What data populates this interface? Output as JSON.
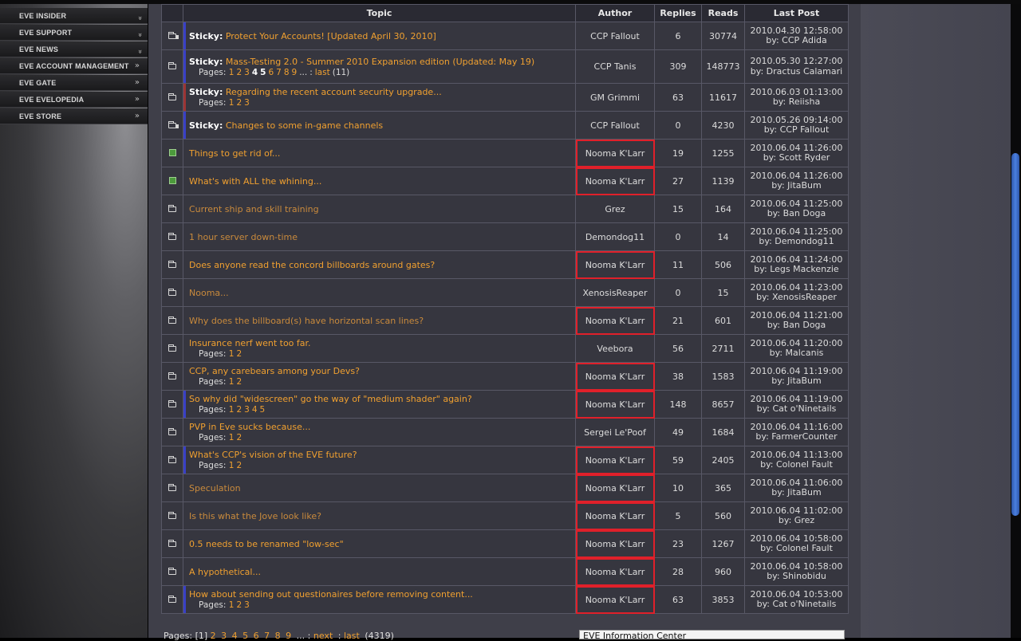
{
  "sidebar": {
    "items": [
      {
        "label": "EVE INSIDER",
        "chevron": "double-down"
      },
      {
        "label": "EVE SUPPORT",
        "chevron": "double-down"
      },
      {
        "label": "EVE NEWS",
        "chevron": "double-down"
      },
      {
        "label": "EVE ACCOUNT MANAGEMENT",
        "chevron": "double-right"
      },
      {
        "label": "EVE GATE",
        "chevron": "double-right"
      },
      {
        "label": "EVE EVELOPEDIA",
        "chevron": "double-right"
      },
      {
        "label": "EVE STORE",
        "chevron": "double-right"
      }
    ]
  },
  "table": {
    "headers": {
      "topic": "Topic",
      "author": "Author",
      "replies": "Replies",
      "reads": "Reads",
      "last_post": "Last Post"
    },
    "rows": [
      {
        "icon": "sticky-folder",
        "bar": "blue",
        "sticky": "Sticky:",
        "title": "Protect Your Accounts! [Updated April 30, 2010]",
        "pages": [],
        "author": "CCP Fallout",
        "marked": false,
        "replies": "6",
        "reads": "30774",
        "date": "2010.04.30 12:58:00",
        "by": "by: CCP Adida"
      },
      {
        "icon": "folder",
        "bar": "blue",
        "sticky": "Sticky:",
        "title": "Mass-Testing 2.0 - Summer 2010 Expansion edition (Updated: May 19)",
        "pages": [
          "1",
          "2",
          "3",
          "4",
          "5",
          "6",
          "7",
          "8",
          "9",
          "...",
          ":",
          "last",
          "(11)"
        ],
        "author": "CCP Tanis",
        "marked": false,
        "replies": "309",
        "reads": "148773",
        "date": "2010.05.30 12:27:00",
        "by": "by: Dractus Calamari",
        "tall": true
      },
      {
        "icon": "folder",
        "bar": "red",
        "sticky": "Sticky:",
        "title": "Regarding the recent account security upgrade...",
        "pages": [
          "1",
          "2",
          "3"
        ],
        "author": "GM Grimmi",
        "marked": false,
        "replies": "63",
        "reads": "11617",
        "date": "2010.06.03 01:13:00",
        "by": "by: Reiisha"
      },
      {
        "icon": "sticky-folder",
        "bar": "blue",
        "sticky": "Sticky:",
        "title": "Changes to some in-game channels",
        "pages": [],
        "author": "CCP Fallout",
        "marked": false,
        "replies": "0",
        "reads": "4230",
        "date": "2010.05.26 09:14:00",
        "by": "by: CCP Fallout"
      },
      {
        "icon": "hot",
        "bar": "",
        "sticky": "",
        "title": "Things to get rid of...",
        "pages": [],
        "author": "Nooma K'Larr",
        "marked": true,
        "replies": "19",
        "reads": "1255",
        "date": "2010.06.04 11:26:00",
        "by": "by: Scott Ryder"
      },
      {
        "icon": "hot",
        "bar": "",
        "sticky": "",
        "title": "What's with ALL the whining...",
        "pages": [],
        "author": "Nooma K'Larr",
        "marked": true,
        "replies": "27",
        "reads": "1139",
        "date": "2010.06.04 11:26:00",
        "by": "by: JitaBum"
      },
      {
        "icon": "folder",
        "bar": "",
        "sticky": "",
        "title": "Current ship and skill training",
        "dim": true,
        "pages": [],
        "author": "Grez",
        "marked": false,
        "replies": "15",
        "reads": "164",
        "date": "2010.06.04 11:25:00",
        "by": "by: Ban Doga"
      },
      {
        "icon": "folder",
        "bar": "",
        "sticky": "",
        "title": "1 hour server down-time",
        "dim": true,
        "pages": [],
        "author": "Demondog11",
        "marked": false,
        "replies": "0",
        "reads": "14",
        "date": "2010.06.04 11:25:00",
        "by": "by: Demondog11"
      },
      {
        "icon": "folder",
        "bar": "",
        "sticky": "",
        "title": "Does anyone read the concord billboards around gates?",
        "pages": [],
        "author": "Nooma K'Larr",
        "marked": true,
        "replies": "11",
        "reads": "506",
        "date": "2010.06.04 11:24:00",
        "by": "by: Legs Mackenzie"
      },
      {
        "icon": "folder",
        "bar": "",
        "sticky": "",
        "title": "Nooma...",
        "dim": true,
        "pages": [],
        "author": "XenosisReaper",
        "marked": false,
        "replies": "0",
        "reads": "15",
        "date": "2010.06.04 11:23:00",
        "by": "by: XenosisReaper"
      },
      {
        "icon": "folder",
        "bar": "",
        "sticky": "",
        "title": "Why does the billboard(s) have horizontal scan lines?",
        "dim": true,
        "pages": [],
        "author": "Nooma K'Larr",
        "marked": true,
        "replies": "21",
        "reads": "601",
        "date": "2010.06.04 11:21:00",
        "by": "by: Ban Doga"
      },
      {
        "icon": "folder",
        "bar": "",
        "sticky": "",
        "title": "Insurance nerf went too far.",
        "pages": [
          "1",
          "2"
        ],
        "author": "Veebora",
        "marked": false,
        "replies": "56",
        "reads": "2711",
        "date": "2010.06.04 11:20:00",
        "by": "by: Malcanis"
      },
      {
        "icon": "folder",
        "bar": "",
        "sticky": "",
        "title": "CCP, any carebears among your Devs?",
        "pages": [
          "1",
          "2"
        ],
        "author": "Nooma K'Larr",
        "marked": true,
        "replies": "38",
        "reads": "1583",
        "date": "2010.06.04 11:19:00",
        "by": "by: JitaBum"
      },
      {
        "icon": "folder",
        "bar": "blue",
        "sticky": "",
        "title": "So why did \"widescreen\" go the way of \"medium shader\" again?",
        "pages": [
          "1",
          "2",
          "3",
          "4",
          "5"
        ],
        "author": "Nooma K'Larr",
        "marked": true,
        "replies": "148",
        "reads": "8657",
        "date": "2010.06.04 11:19:00",
        "by": "by: Cat o'Ninetails"
      },
      {
        "icon": "folder",
        "bar": "",
        "sticky": "",
        "title": "PVP in Eve sucks because...",
        "pages": [
          "1",
          "2"
        ],
        "author": "Sergei Le'Poof",
        "marked": false,
        "replies": "49",
        "reads": "1684",
        "date": "2010.06.04 11:16:00",
        "by": "by: FarmerCounter"
      },
      {
        "icon": "folder",
        "bar": "blue",
        "sticky": "",
        "title": "What's CCP's vision of the EVE future?",
        "pages": [
          "1",
          "2"
        ],
        "author": "Nooma K'Larr",
        "marked": true,
        "replies": "59",
        "reads": "2405",
        "date": "2010.06.04 11:13:00",
        "by": "by: Colonel Fault"
      },
      {
        "icon": "folder",
        "bar": "",
        "sticky": "",
        "title": "Speculation",
        "dim": true,
        "pages": [],
        "author": "Nooma K'Larr",
        "marked": true,
        "replies": "10",
        "reads": "365",
        "date": "2010.06.04 11:06:00",
        "by": "by: JitaBum"
      },
      {
        "icon": "folder",
        "bar": "",
        "sticky": "",
        "title": "Is this what the Jove look like?",
        "dim": true,
        "pages": [],
        "author": "Nooma K'Larr",
        "marked": true,
        "replies": "5",
        "reads": "560",
        "date": "2010.06.04 11:02:00",
        "by": "by: Grez"
      },
      {
        "icon": "folder",
        "bar": "",
        "sticky": "",
        "title": "0.5 needs to be renamed \"low-sec\"",
        "pages": [],
        "author": "Nooma K'Larr",
        "marked": true,
        "replies": "23",
        "reads": "1267",
        "date": "2010.06.04 10:58:00",
        "by": "by: Colonel Fault"
      },
      {
        "icon": "folder",
        "bar": "",
        "sticky": "",
        "title": "A hypothetical...",
        "pages": [],
        "author": "Nooma K'Larr",
        "marked": true,
        "replies": "28",
        "reads": "960",
        "date": "2010.06.04 10:58:00",
        "by": "by: Shinobidu"
      },
      {
        "icon": "folder",
        "bar": "blue",
        "sticky": "",
        "title": "How about sending out questionaires before removing content...",
        "pages": [
          "1",
          "2",
          "3"
        ],
        "author": "Nooma K'Larr",
        "marked": true,
        "replies": "63",
        "reads": "3853",
        "date": "2010.06.04 10:53:00",
        "by": "by: Cat o'Ninetails"
      }
    ]
  },
  "footer": {
    "pages_label": "Pages:",
    "current": "[1]",
    "pages": [
      "2",
      "3",
      "4",
      "5",
      "6",
      "7",
      "8",
      "9"
    ],
    "ellipsis": "...",
    "sep": ":",
    "next": "next",
    "last": "last",
    "total": "(4319)",
    "select_value": "EVE Information Center"
  },
  "colors": {
    "link": "#f0a030",
    "marker": "#e0202a",
    "sticky_bar": "#3940c6",
    "scroll_thumb": "#4a7fe0"
  }
}
